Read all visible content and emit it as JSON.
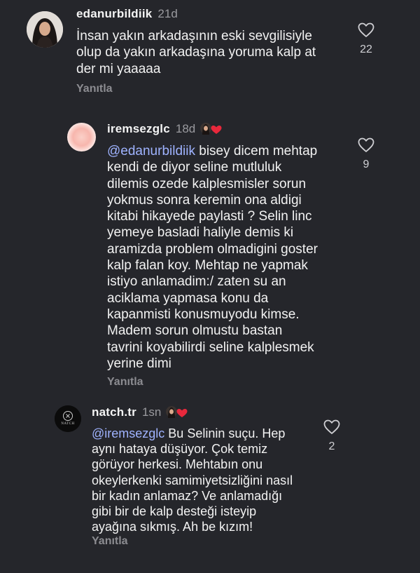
{
  "comments": [
    {
      "username": "edanurbildiik",
      "time": "21d",
      "mention": "",
      "lines": [
        "İnsan yakın arkadaşının eski sevgilisiyle",
        "olup da yakın arkadaşına yoruma kalp at",
        "der mi yaaaaa"
      ],
      "likes": "22",
      "reply_label": "Yanıtla"
    },
    {
      "username": "iremsezglc",
      "time": "18d",
      "mention": "@edanurbildiik",
      "lines": [
        " bisey dicem mehtap",
        "kendi de diyor seline mutluluk",
        "dilemis ozede kalplesmisler sorun",
        "yokmus sonra keremin ona aldigi",
        "kitabi hikayede paylasti ? Selin linc",
        "yemeye basladi haliyle demis ki",
        "aramizda problem olmadigini goster",
        "kalp falan koy. Mehtap ne yapmak",
        "istiyo anlamadim:/ zaten su an",
        "aciklama yapmasa konu da",
        "kapanmisti konusmuyodu kimse.",
        "Madem sorun olmustu bastan",
        "tavrini koyabilirdi seline kalplesmek",
        "yerine dimi"
      ],
      "likes": "9",
      "reply_label": "Yanıtla"
    },
    {
      "username": "natch.tr",
      "time": "1sn",
      "mention": "@iremsezglc",
      "lines": [
        " Bu Selinin suçu. Hep",
        "aynı hataya düşüyor. Çok temiz",
        "görüyor herkesi. Mehtabın onu",
        "okeylerkenki samimiyetsizliğini nasıl",
        "bir kadın anlamaz? Ve anlamadığı",
        "gibi bir de kalp desteği isteyip",
        "ayağına sıkmış. Ah be kızım!"
      ],
      "likes": "2",
      "reply_label": "Yanıtla",
      "avatar_text": "NATCH"
    }
  ],
  "colors": {
    "background": "#25262b",
    "mention": "#9fb3ff",
    "muted": "#8c8c91",
    "heart_badge": "#e8283c"
  }
}
